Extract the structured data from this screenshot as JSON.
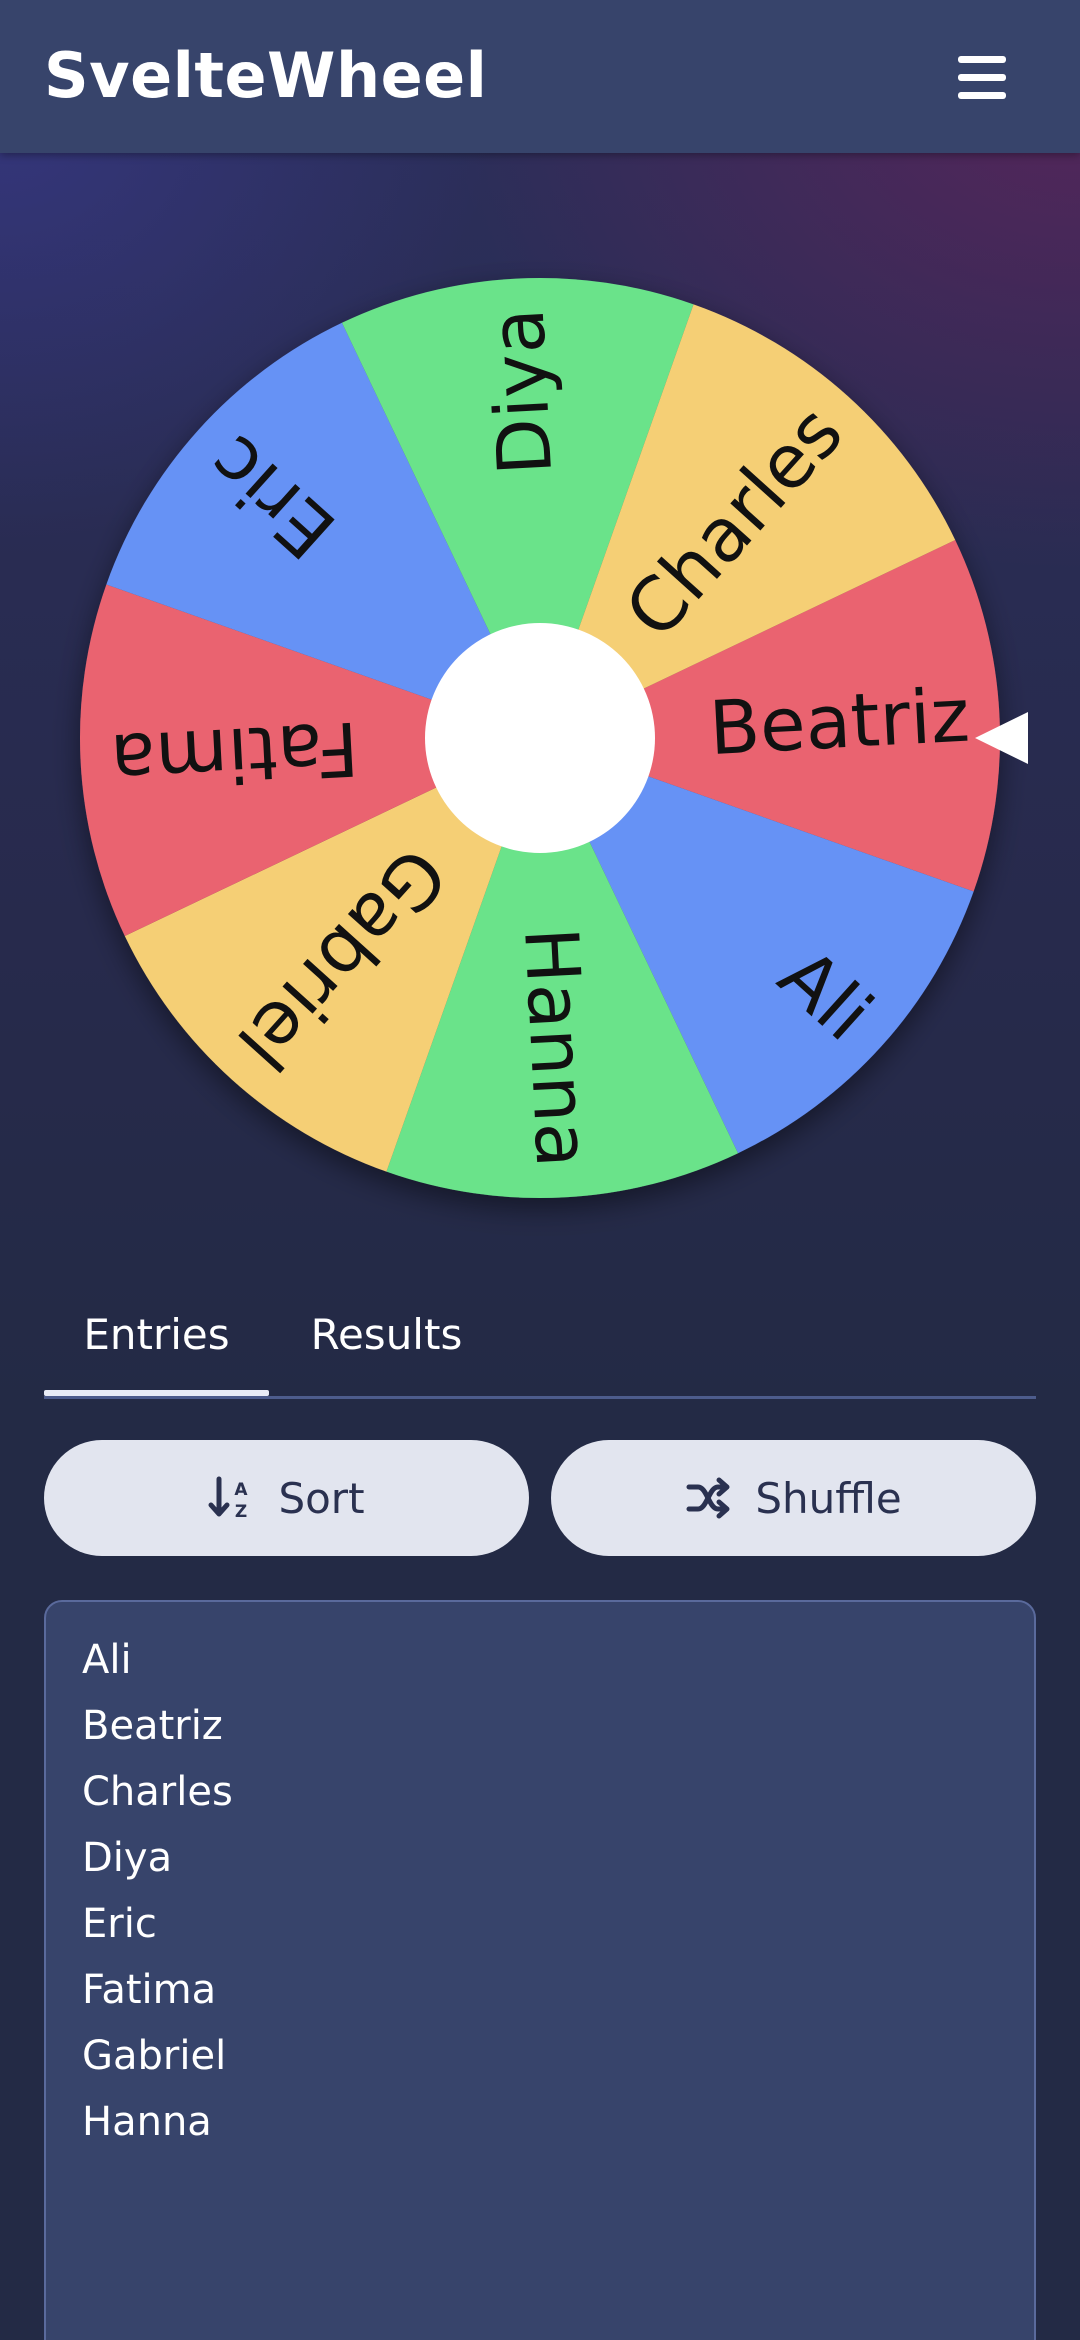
{
  "app": {
    "title": "SvelteWheel",
    "menu_icon": "hamburger-menu-icon"
  },
  "wheel": {
    "segments": [
      {
        "label": "Beatriz",
        "color": "#ea6470"
      },
      {
        "label": "Ali",
        "color": "#6692f5"
      },
      {
        "label": "Hanna",
        "color": "#6ae38a"
      },
      {
        "label": "Gabriel",
        "color": "#f5cf74"
      },
      {
        "label": "Fatima",
        "color": "#ea6470"
      },
      {
        "label": "Eric",
        "color": "#6692f5"
      },
      {
        "label": "Diya",
        "color": "#6ae38a"
      },
      {
        "label": "Charles",
        "color": "#f5cf74"
      }
    ],
    "pointer_icon": "triangle-pointer-icon",
    "hub_color": "#ffffff"
  },
  "tabs": {
    "entries": "Entries",
    "results": "Results",
    "active": "entries"
  },
  "actions": {
    "sort_label": "Sort",
    "sort_icon": "sort-az-icon",
    "shuffle_label": "Shuffle",
    "shuffle_icon": "shuffle-icon"
  },
  "entries": [
    "Ali",
    "Beatriz",
    "Charles",
    "Diya",
    "Eric",
    "Fatima",
    "Gabriel",
    "Hanna"
  ],
  "colors": {
    "topbar": "#37446b",
    "background": "#232a45",
    "button": "#e2e5ef",
    "textarea": "#37446b"
  }
}
